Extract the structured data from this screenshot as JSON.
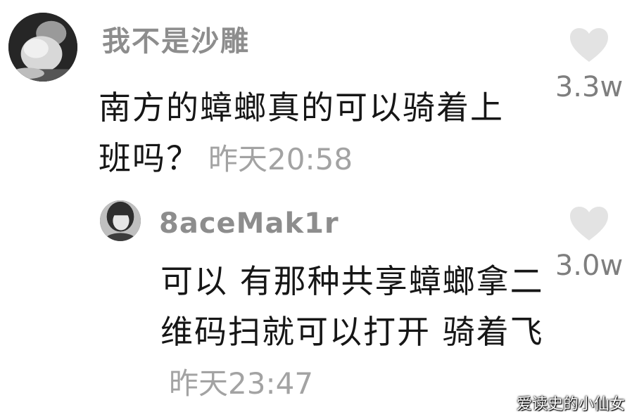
{
  "comment": {
    "username": "我不是沙雕",
    "avatar_icon": "avatar-photo",
    "text": "南方的蟑螂真的可以骑着上班吗？",
    "timestamp": "昨天20:58",
    "likes": "3.3w"
  },
  "reply": {
    "username": "8aceMak1r",
    "avatar_icon": "avatar-photo",
    "text": "可以 有那种共享蟑螂拿二维码扫就可以打开 骑着飞",
    "timestamp": "昨天23:47",
    "likes": "3.0w"
  },
  "like_icon": "heart-icon",
  "watermark": "爱读史的小仙女",
  "colors": {
    "username": "#8d8d8d",
    "text": "#161616",
    "timestamp": "#a3a3a3",
    "heart": "#e3e3e3",
    "count": "#7e7e7e"
  }
}
